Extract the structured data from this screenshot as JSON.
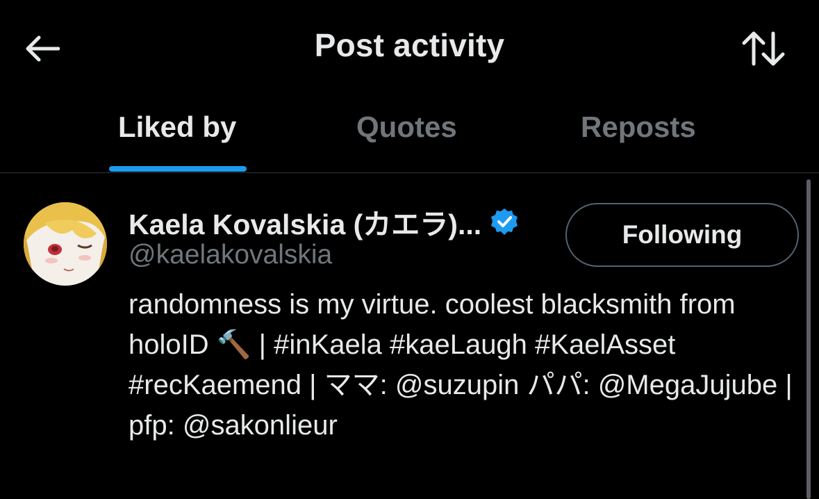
{
  "header": {
    "title": "Post activity",
    "back_icon": "arrow-left-icon",
    "sort_icon": "sort-arrows-icon"
  },
  "tabs": [
    {
      "label": "Liked by",
      "active": true
    },
    {
      "label": "Quotes",
      "active": false
    },
    {
      "label": "Reposts",
      "active": false
    }
  ],
  "users": [
    {
      "name": "Kaela Kovalskia (カエラ)...",
      "verified": true,
      "handle": "@kaelakovalskia",
      "button_label": "Following",
      "bio": "randomness is my virtue. coolest blacksmith from holoID 🔨 | #inKaela #kaeLaugh #KaelAsset #recKaemend | ママ: @suzupin パパ: @MegaJujube | pfp: @sakonlieur"
    }
  ],
  "colors": {
    "background": "#000000",
    "text": "#e7e9ea",
    "muted": "#71767b",
    "accent": "#1d9bf0",
    "divider": "#2f3336"
  }
}
